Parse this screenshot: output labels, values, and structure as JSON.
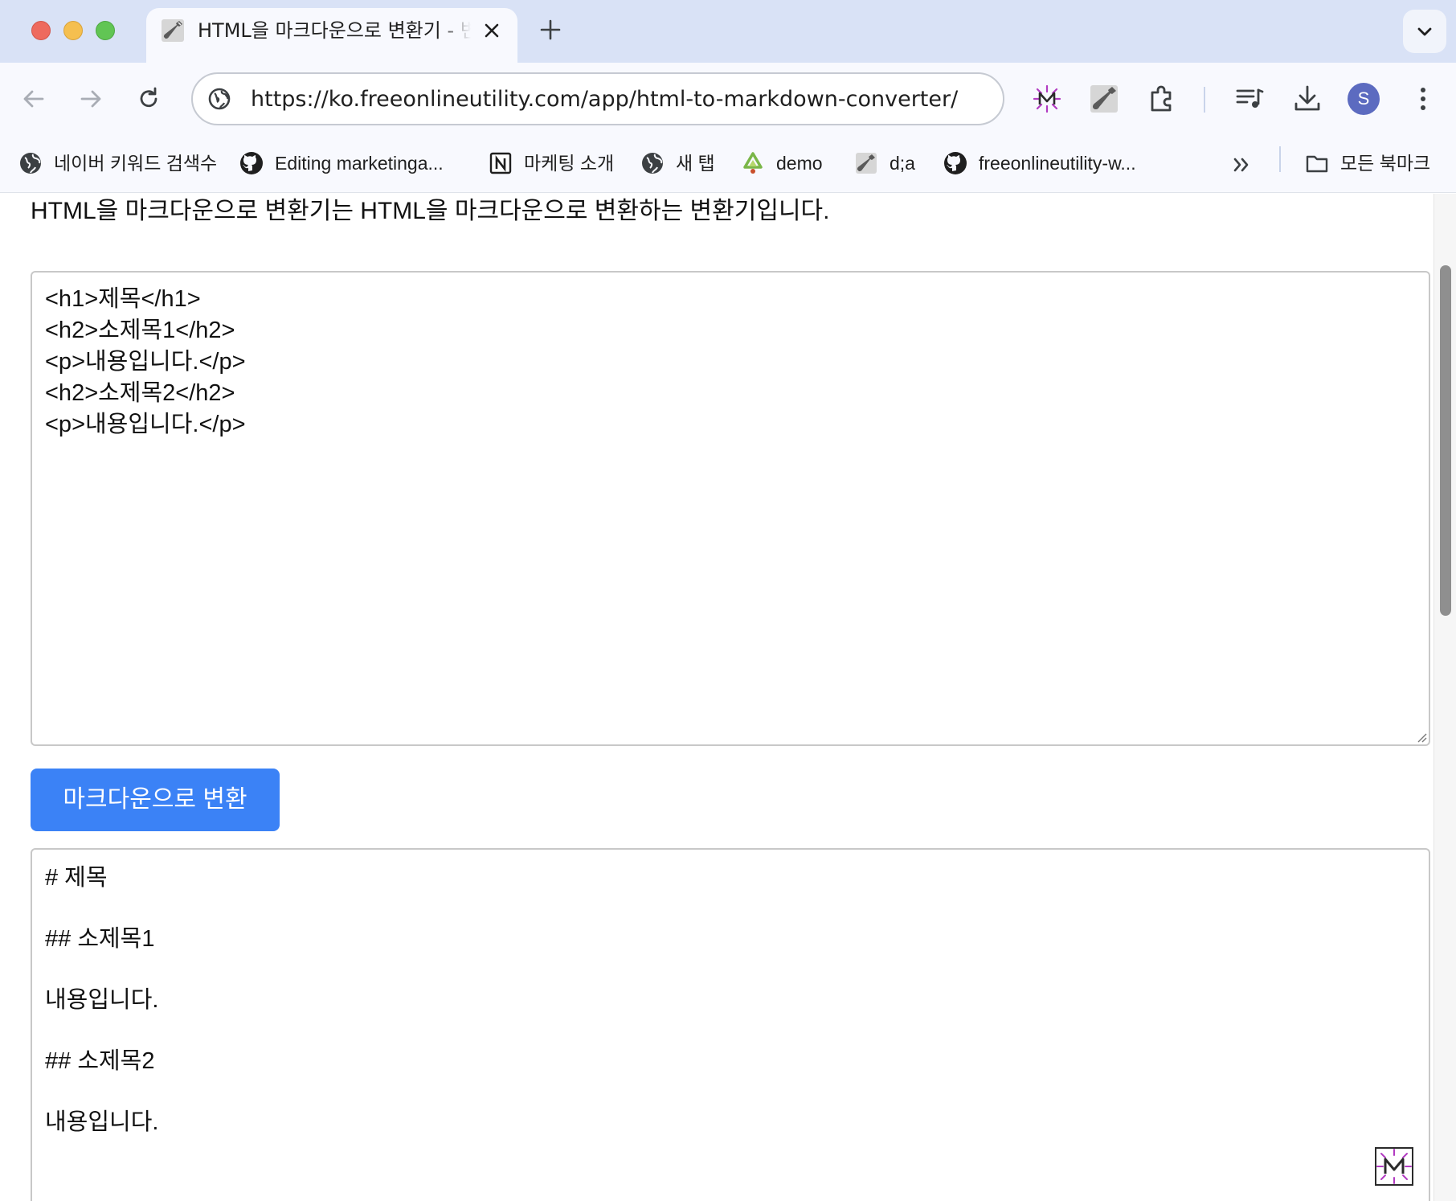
{
  "browser": {
    "tab": {
      "title": "HTML을 마크다운으로 변환기 - 변환기 | FreeOnlineUtility"
    },
    "address_bar": {
      "url": "https://ko.freeonlineutility.com/app/html-to-markdown-converter/"
    },
    "profile": {
      "initial": "S",
      "color": "#5c6bc0"
    },
    "bookmarks": [
      {
        "label": "네이버 키워드 검색수",
        "icon": "globe-icon"
      },
      {
        "label": "Editing marketinga...",
        "icon": "github-icon"
      },
      {
        "label": "마케팅 소개",
        "icon": "notion-icon"
      },
      {
        "label": "새 탭",
        "icon": "globe-icon"
      },
      {
        "label": "demo",
        "icon": "recycle-icon"
      },
      {
        "label": "d;a",
        "icon": "wrench-icon"
      },
      {
        "label": "freeonlineutility-w...",
        "icon": "github-icon"
      }
    ],
    "all_bookmarks_label": "모든 북마크"
  },
  "page": {
    "intro": "HTML을 마크다운으로 변환기는 HTML을 마크다운으로 변환하는 변환기입니다.",
    "html_input": "<h1>제목</h1>\n<h2>소제목1</h2>\n<p>내용입니다.</p>\n<h2>소제목2</h2>\n<p>내용입니다.</p>",
    "convert_button": "마크다운으로 변환",
    "markdown_output": [
      "# 제목",
      "## 소제목1",
      "내용입니다.",
      "## 소제목2",
      "내용입니다."
    ]
  },
  "colors": {
    "accent_button": "#3b82f6",
    "tab_strip": "#d9e2f6",
    "toolbar": "#f8f9fe"
  }
}
